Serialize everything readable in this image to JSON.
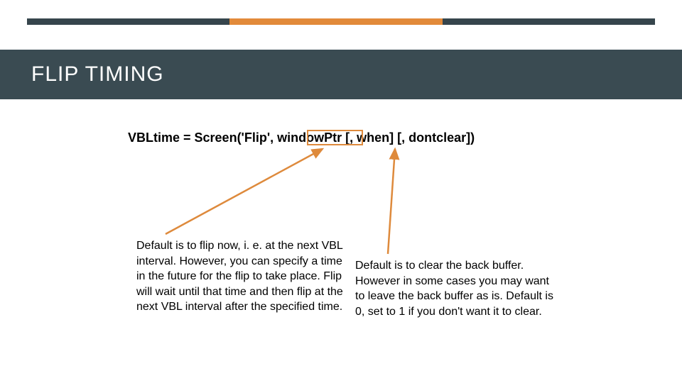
{
  "title": "FLIP TIMING",
  "code_line": "VBLtime = Screen('Flip', windowPtr [, when] [, dontclear])",
  "para_left": "Default is to flip now, i. e. at the next VBL interval.  However, you can specify a time in the future for the flip to take place. Flip will wait until that time and then flip at the next VBL interval after the specified time.",
  "para_right": "Default is to clear the back buffer. However in some cases you may want to leave the back buffer as is. Default is 0, set to 1 if you don't want it to clear.",
  "colors": {
    "accent": "#de8a3c",
    "band": "#3a4b52"
  }
}
